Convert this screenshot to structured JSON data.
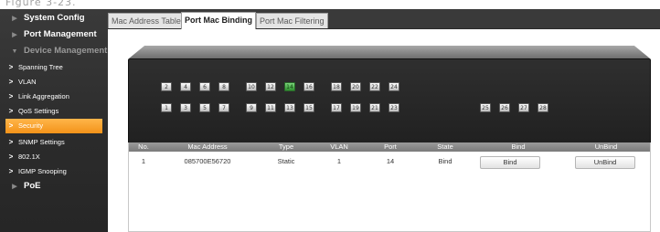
{
  "caption": "Figure 3-23.",
  "sidebar": {
    "items": [
      {
        "label": "System Config"
      },
      {
        "label": "Port Management"
      },
      {
        "label": "Device Management"
      },
      {
        "label": "Spanning Tree"
      },
      {
        "label": "VLAN"
      },
      {
        "label": "Link Aggregation"
      },
      {
        "label": "QoS Settings"
      },
      {
        "label": "Security"
      },
      {
        "label": "SNMP Settings"
      },
      {
        "label": "802.1X"
      },
      {
        "label": "IGMP Snooping"
      },
      {
        "label": "PoE"
      }
    ],
    "active_label": "Security",
    "active_color": "#f39319"
  },
  "tabs": [
    {
      "label": "Mac Address Table"
    },
    {
      "label": "Port Mac Binding"
    },
    {
      "label": "Port Mac Filtering"
    }
  ],
  "active_tab": "Port Mac Binding",
  "switch_panel": {
    "top_row": [
      "2",
      "4",
      "6",
      "8",
      "10",
      "12",
      "14",
      "16",
      "18",
      "20",
      "22",
      "24"
    ],
    "bottom_row": [
      "1",
      "3",
      "5",
      "7",
      "9",
      "11",
      "13",
      "15",
      "17",
      "19",
      "21",
      "23"
    ],
    "uplink_ports": [
      "25",
      "26",
      "27",
      "28"
    ],
    "selected_port": "14",
    "selected_color": "#3aa53a"
  },
  "table": {
    "headers": [
      "No.",
      "Mac Address",
      "Type",
      "VLAN",
      "Port",
      "State",
      "Bind",
      "UnBind"
    ],
    "rows": [
      {
        "no": "1",
        "mac_address": "085700E56720",
        "type": "Static",
        "vlan": "1",
        "port": "14",
        "state": "Bind",
        "bind_button": "Bind",
        "unbind_button": "UnBind"
      }
    ]
  }
}
